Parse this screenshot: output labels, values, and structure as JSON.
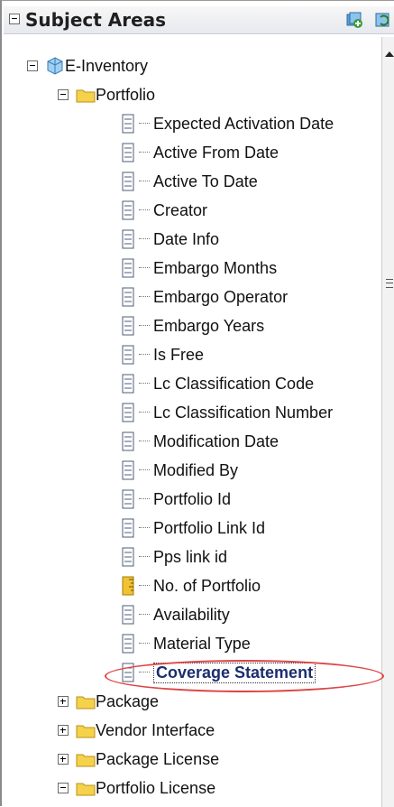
{
  "header": {
    "title": "Subject Areas",
    "add_icon": "add-subject-area-icon",
    "refresh_icon": "refresh-icon"
  },
  "root": {
    "label": "E-Inventory",
    "icon": "subject-area-cube-icon"
  },
  "portfolio": {
    "label": "Portfolio",
    "columns": [
      {
        "label": "Expected Activation Date",
        "icon": "attribute-column-icon"
      },
      {
        "label": "Active From Date",
        "icon": "attribute-column-icon"
      },
      {
        "label": "Active To Date",
        "icon": "attribute-column-icon"
      },
      {
        "label": "Creator",
        "icon": "attribute-column-icon"
      },
      {
        "label": "Date Info",
        "icon": "attribute-column-icon"
      },
      {
        "label": "Embargo Months",
        "icon": "attribute-column-icon"
      },
      {
        "label": "Embargo Operator",
        "icon": "attribute-column-icon"
      },
      {
        "label": "Embargo Years",
        "icon": "attribute-column-icon"
      },
      {
        "label": "Is Free",
        "icon": "attribute-column-icon"
      },
      {
        "label": "Lc Classification Code",
        "icon": "attribute-column-icon"
      },
      {
        "label": "Lc Classification Number",
        "icon": "attribute-column-icon"
      },
      {
        "label": "Modification Date",
        "icon": "attribute-column-icon"
      },
      {
        "label": "Modified By",
        "icon": "attribute-column-icon"
      },
      {
        "label": "Portfolio Id",
        "icon": "attribute-column-icon"
      },
      {
        "label": "Portfolio Link Id",
        "icon": "attribute-column-icon"
      },
      {
        "label": "Pps link id",
        "icon": "attribute-column-icon"
      },
      {
        "label": "No. of Portfolio",
        "icon": "measure-column-icon"
      },
      {
        "label": "Availability",
        "icon": "attribute-column-icon"
      },
      {
        "label": "Material Type",
        "icon": "attribute-column-icon"
      },
      {
        "label": "Coverage Statement",
        "icon": "attribute-column-icon",
        "selected": true
      }
    ]
  },
  "folders": [
    {
      "label": "Package",
      "expanded": false
    },
    {
      "label": "Vendor Interface",
      "expanded": false
    },
    {
      "label": "Package License",
      "expanded": false
    },
    {
      "label": "Portfolio License",
      "expanded": true
    }
  ],
  "colors": {
    "folder": "#f5d24a",
    "highlight_ring": "#dd4444",
    "selected_text": "#1b2e6e"
  }
}
